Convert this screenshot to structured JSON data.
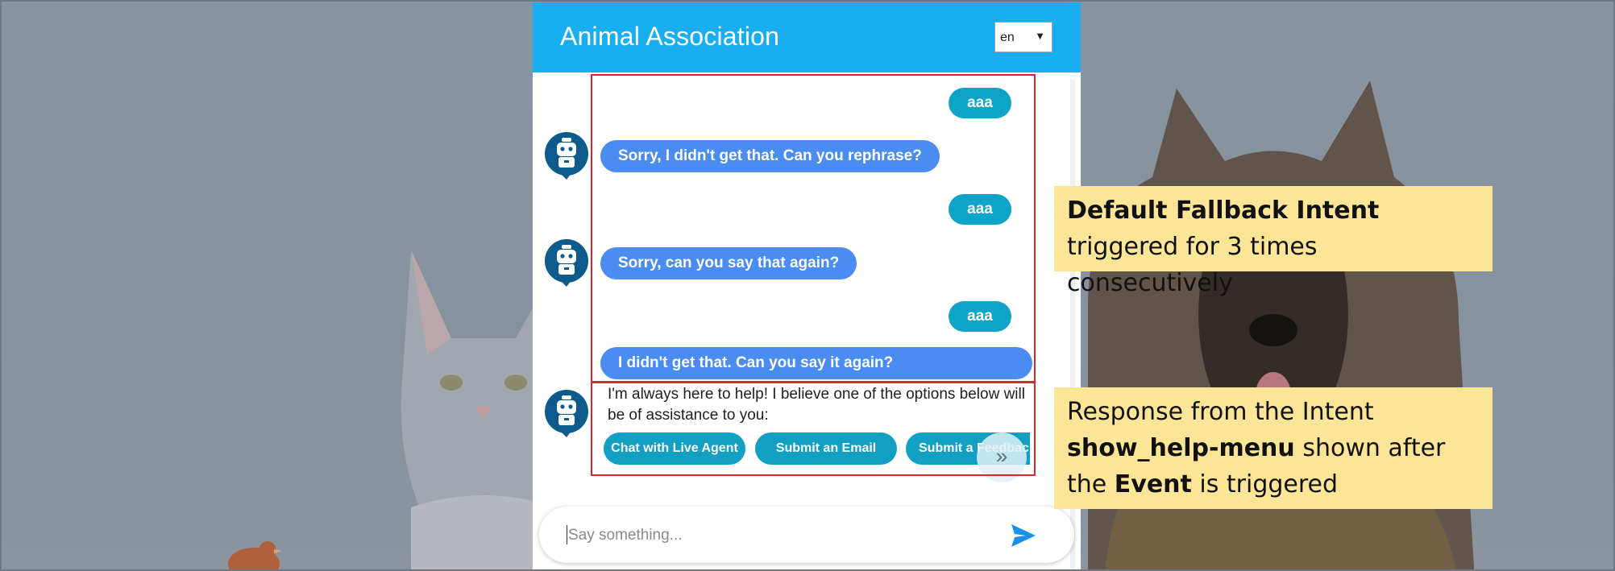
{
  "app": {
    "title": "Animal Association",
    "language": "en"
  },
  "messages": [
    {
      "from": "user",
      "text": "aaa"
    },
    {
      "from": "bot",
      "text": "Sorry, I didn't get that. Can you rephrase?"
    },
    {
      "from": "user",
      "text": "aaa"
    },
    {
      "from": "bot",
      "text": "Sorry, can you say that again?"
    },
    {
      "from": "user",
      "text": "aaa"
    },
    {
      "from": "bot",
      "text": "I didn't get that. Can you say it again?"
    }
  ],
  "help": {
    "text": "I'm always here to help! I believe one of the options below will be of assistance to you:",
    "chips": [
      "Chat with Live Agent",
      "Submit an Email",
      "Submit a Feedback"
    ]
  },
  "input": {
    "placeholder": "Say something..."
  },
  "annotations": {
    "fallback": {
      "bold": "Default Fallback Intent",
      "rest": " triggered for 3 times consecutively"
    },
    "response": {
      "p1": "Response from the Intent ",
      "bold1": "show_help-menu",
      "p2": " shown after the ",
      "bold2": "Event",
      "p3": " is triggered"
    }
  },
  "colors": {
    "header": "#18aef0",
    "user_bubble": "#0ea3c8",
    "bot_bubble": "#4a8cf0",
    "chip": "#11a0c4",
    "highlight": "#d9262c",
    "callout_bg": "#fde598"
  },
  "icons": {
    "avatar": "robot-avatar-icon",
    "send": "send-icon",
    "scroll": "double-chevron-right-icon",
    "dropdown": "caret-down-icon"
  }
}
